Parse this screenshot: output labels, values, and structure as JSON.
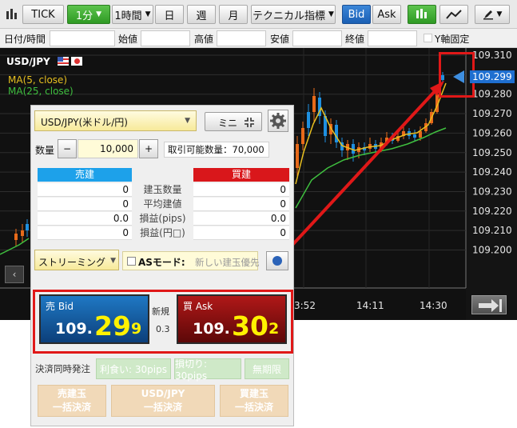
{
  "toolbar": {
    "tick": "TICK",
    "tf_1m": "1分",
    "tf_1h": "1時間",
    "tf_day": "日",
    "tf_week": "週",
    "tf_month": "月",
    "indicators": "テクニカル指標",
    "bid": "Bid",
    "ask": "Ask"
  },
  "ohlc": {
    "datetime": "日付/時間",
    "open": "始値",
    "high": "高値",
    "low": "安値",
    "close": "終値",
    "y_fixed": "Y軸固定"
  },
  "chart": {
    "symbol": "USD/JPY",
    "ma5": "MA(5, close)",
    "ma25": "MA(25, close)",
    "y_ticks": [
      "109.310",
      "109.299",
      "109.290",
      "109.280",
      "109.270",
      "109.260",
      "109.250",
      "109.240",
      "109.230",
      "109.220",
      "109.210",
      "109.200"
    ],
    "current_price": "109.299",
    "x_ticks": [
      "3:52",
      "14:11",
      "14:30"
    ],
    "colors": {
      "up": "#e86a1a",
      "down": "#1e90e0",
      "ma5": "#e8c020",
      "ma25": "#3fbf3f"
    }
  },
  "panel": {
    "pair": "USD/JPY(米ドル/円)",
    "mini": "ミニ",
    "qty_label": "数量",
    "qty_minus": "−",
    "qty_value": "10,000",
    "qty_plus": "+",
    "available": "取引可能数量：70,000",
    "sell_header": "売建",
    "buy_header": "買建",
    "rows": [
      {
        "label": "建玉数量",
        "sell": "0",
        "buy": "0"
      },
      {
        "label": "平均建値",
        "sell": "0",
        "buy": "0"
      },
      {
        "label": "損益(pips)",
        "sell": "0.0",
        "buy": "0.0"
      },
      {
        "label": "損益(円□)",
        "sell": "0",
        "buy": "0"
      }
    ],
    "streaming": "ストリーミング",
    "as_mode": "ASモード:",
    "as_mode_value": "新しい建玉優先",
    "bid_label": "売 Bid",
    "bid_prefix": "109.",
    "bid_big": "29",
    "bid_tail": "9",
    "new_label": "新規",
    "spread": "0.3",
    "ask_label": "買 Ask",
    "ask_prefix": "109.",
    "ask_big": "30",
    "ask_tail": "2",
    "settle_label": "決済同時発注",
    "take_profit": "利食い: 30pips",
    "stop_loss": "損切り: 30pips",
    "no_limit": "無期限",
    "btn_sell_close_1": "売建玉",
    "btn_sell_close_2": "一括決済",
    "btn_pair_close_1": "USD/JPY",
    "btn_pair_close_2": "一括決済",
    "btn_buy_close_1": "買建玉",
    "btn_buy_close_2": "一括決済"
  }
}
